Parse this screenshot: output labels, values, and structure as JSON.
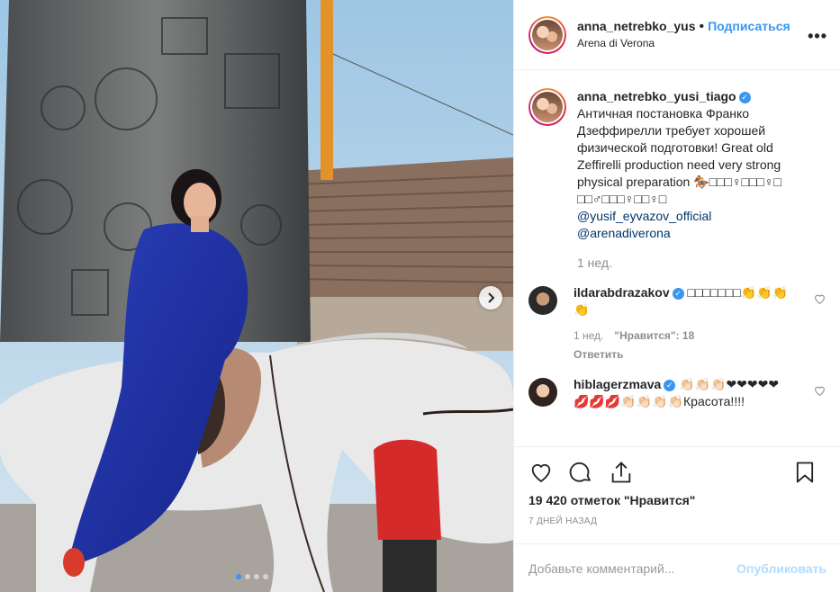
{
  "header": {
    "username": "anna_netrebko_yus",
    "dot": "•",
    "follow": "Подписаться",
    "location": "Arena di Verona",
    "more": "•••"
  },
  "caption": {
    "username": "anna_netrebko_yusi_tiago",
    "text": "Античная постановка Франко Дзеффирелли требует хорошей физической подготовки! Great old Zeffirelli production need very strong physical preparation 🏇□□□♀□□□♀□ □□♂□□□♀□□♀□",
    "mention1": "@yusif_eyvazov_official",
    "mention2": "@arenadiverona",
    "time": "1 нед."
  },
  "comments": [
    {
      "username": "ildarabdrazakov",
      "text": "□□□□□□□👏👏👏👏",
      "time": "1 нед.",
      "likes": "\"Нравится\": 18",
      "reply": "Ответить"
    },
    {
      "username": "hiblagerzmava",
      "text": "👏🏻👏🏻👏🏻❤❤❤❤❤💋💋💋👏🏻👏🏻👏🏻👏🏻Красота!!!!"
    }
  ],
  "likes": "19 420 отметок \"Нравится\"",
  "date": "7 ДНЕЙ НАЗАД",
  "add_comment": {
    "placeholder": "Добавьте комментарий...",
    "publish": "Опубликовать"
  },
  "icons": {
    "like": "heart-icon",
    "comment": "comment-icon",
    "share": "share-icon",
    "save": "bookmark-icon"
  },
  "colors": {
    "link": "#3897f0",
    "mention": "#003569",
    "muted": "#8e8e8e",
    "heart": "#ed4956"
  }
}
